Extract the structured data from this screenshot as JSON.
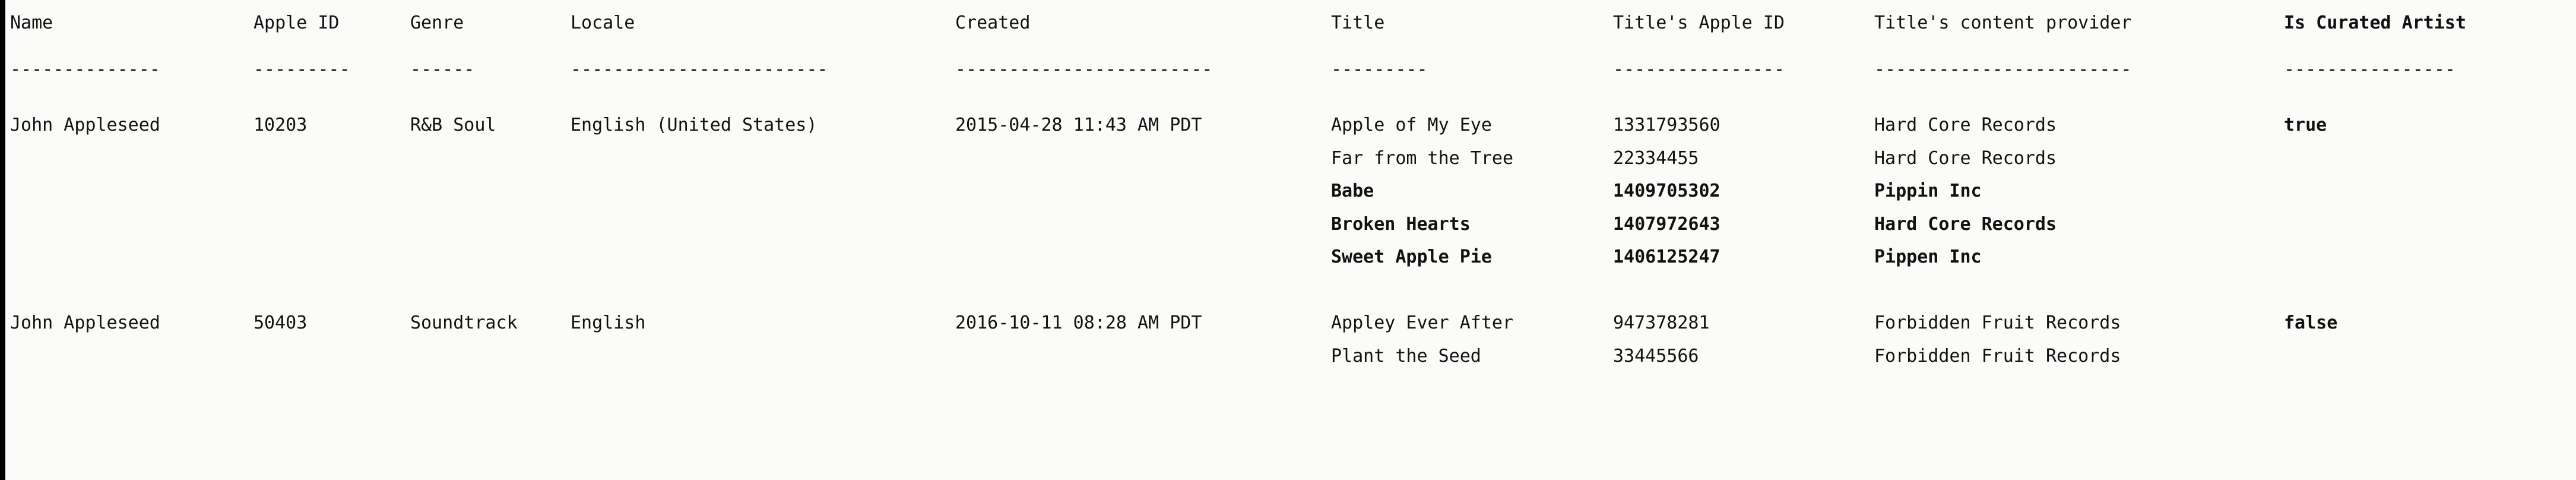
{
  "table": {
    "columns": [
      {
        "key": "name",
        "label": "Name",
        "rule": "--------------",
        "bold": false
      },
      {
        "key": "apple_id",
        "label": "Apple ID",
        "rule": "---------",
        "bold": false
      },
      {
        "key": "genre",
        "label": "Genre",
        "rule": "------",
        "bold": false
      },
      {
        "key": "locale",
        "label": "Locale",
        "rule": "------------------------",
        "bold": false
      },
      {
        "key": "created",
        "label": "Created",
        "rule": "------------------------",
        "bold": false
      },
      {
        "key": "title",
        "label": "Title",
        "rule": "---------",
        "bold": false
      },
      {
        "key": "title_id",
        "label": "Title's Apple ID",
        "rule": "----------------",
        "bold": false
      },
      {
        "key": "provider",
        "label": "Title's content provider",
        "rule": "------------------------",
        "bold": false
      },
      {
        "key": "curated",
        "label": "Is Curated Artist",
        "rule": "----------------",
        "bold": true
      }
    ],
    "rows": [
      {
        "name": "John Appleseed",
        "apple_id": "10203",
        "genre": "R&B Soul",
        "locale": "English (United States)",
        "created": "2015-04-28 11:43 AM PDT",
        "title": "Apple of My Eye",
        "title_id": "1331793560",
        "provider": "Hard Core Records",
        "curated": "true",
        "bold": false,
        "curated_bold": true
      },
      {
        "name": "",
        "apple_id": "",
        "genre": "",
        "locale": "",
        "created": "",
        "title": "Far from the Tree",
        "title_id": "22334455",
        "provider": "Hard Core Records",
        "curated": "",
        "bold": false,
        "curated_bold": false
      },
      {
        "name": "",
        "apple_id": "",
        "genre": "",
        "locale": "",
        "created": "",
        "title": "Babe",
        "title_id": "1409705302",
        "provider": "Pippin Inc",
        "curated": "",
        "bold": true,
        "curated_bold": false
      },
      {
        "name": "",
        "apple_id": "",
        "genre": "",
        "locale": "",
        "created": "",
        "title": "Broken Hearts",
        "title_id": "1407972643",
        "provider": "Hard Core Records",
        "curated": "",
        "bold": true,
        "curated_bold": false
      },
      {
        "name": "",
        "apple_id": "",
        "genre": "",
        "locale": "",
        "created": "",
        "title": "Sweet Apple Pie",
        "title_id": "1406125247",
        "provider": "Pippen Inc",
        "curated": "",
        "bold": true,
        "curated_bold": false
      },
      {
        "name": "",
        "apple_id": "",
        "genre": "",
        "locale": "",
        "created": "",
        "title": "",
        "title_id": "",
        "provider": "",
        "curated": "",
        "bold": false,
        "curated_bold": false
      },
      {
        "name": "John Appleseed",
        "apple_id": "50403",
        "genre": "Soundtrack",
        "locale": "English",
        "created": "2016-10-11 08:28 AM PDT",
        "title": "Appley Ever After",
        "title_id": "947378281",
        "provider": "Forbidden Fruit Records",
        "curated": "false",
        "bold": false,
        "curated_bold": true
      },
      {
        "name": "",
        "apple_id": "",
        "genre": "",
        "locale": "",
        "created": "",
        "title": "Plant the Seed",
        "title_id": "33445566",
        "provider": "Forbidden Fruit Records",
        "curated": "",
        "bold": false,
        "curated_bold": false
      }
    ]
  },
  "style": {
    "background": "#fbfbf9",
    "text_color": "#111111",
    "left_rule_color": "#000000"
  }
}
